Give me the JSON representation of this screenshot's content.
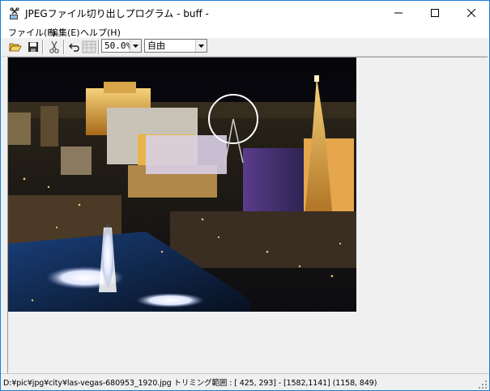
{
  "window": {
    "title": "JPEGファイル切り出しプログラム - buff -"
  },
  "menu": [
    {
      "label": "ファイル(F)"
    },
    {
      "label": "編集(E)"
    },
    {
      "label": "ヘルプ(H)"
    }
  ],
  "toolbar": {
    "zoom": "50.0%",
    "ratio": "自由"
  },
  "status": {
    "text": "D:¥pic¥jpg¥city¥las-vegas-680953_1920.jpg トリミング範囲 : [ 425, 293] - [1582,1141] (1158, 849)"
  },
  "colors": {
    "accent": "#1a7fd4",
    "chrome": "#f0f0f0"
  },
  "icons": [
    "app-icon",
    "minimize-icon",
    "maximize-icon",
    "close-icon",
    "open-folder-icon",
    "save-icon",
    "scissors-icon",
    "undo-icon",
    "crop-grid-icon"
  ]
}
